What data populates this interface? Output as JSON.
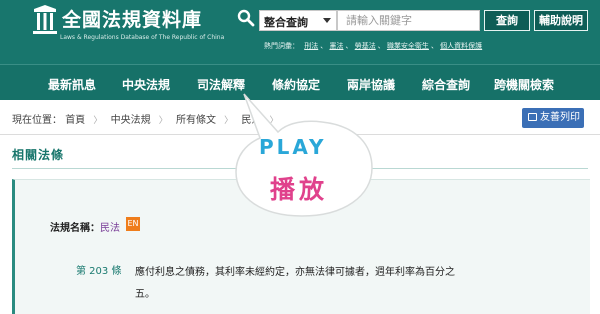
{
  "header": {
    "title": "全國法規資料庫",
    "subtitle": "Laws & Regulations Database of The Republic of China",
    "search": {
      "scope_selected": "整合查詢",
      "placeholder": "請輸入關鍵字",
      "search_label": "查詢",
      "help_label": "輔助說明"
    },
    "hot_label": "熱門詞彙：",
    "hot_terms": [
      "刑法",
      "憲法",
      "勞基法",
      "職業安全衛生",
      "個人資料保護"
    ]
  },
  "nav": {
    "items": [
      "最新訊息",
      "中央法規",
      "司法解釋",
      "條約協定",
      "兩岸協議",
      "綜合查詢",
      "跨機關檢索"
    ]
  },
  "breadcrumb": {
    "prefix": "現在位置：",
    "items": [
      "首頁",
      "中央法規",
      "所有條文",
      "民法"
    ]
  },
  "print_label": "友善列印",
  "section_title": "相關法條",
  "law": {
    "label": "法規名稱：",
    "name": "民法",
    "en_badge": "EN",
    "article_no": "第 203 條",
    "article_text": "應付利息之債務，其利率未經約定，亦無法律可據者，週年利率為百分之五。"
  },
  "overlay": {
    "play_en": "PLAY",
    "play_zh": "播放",
    "colors": {
      "en": "#2aa7d8",
      "zh": "#e0418c"
    }
  },
  "colors": {
    "header_bg": "#18766d",
    "nav_bg": "#167168",
    "accent": "#17756b",
    "print_button": "#3b6fb6",
    "en_badge": "#ef7d1b"
  },
  "icons": [
    "scales-logo-icon",
    "search-icon",
    "caret-down-icon",
    "printer-icon"
  ]
}
